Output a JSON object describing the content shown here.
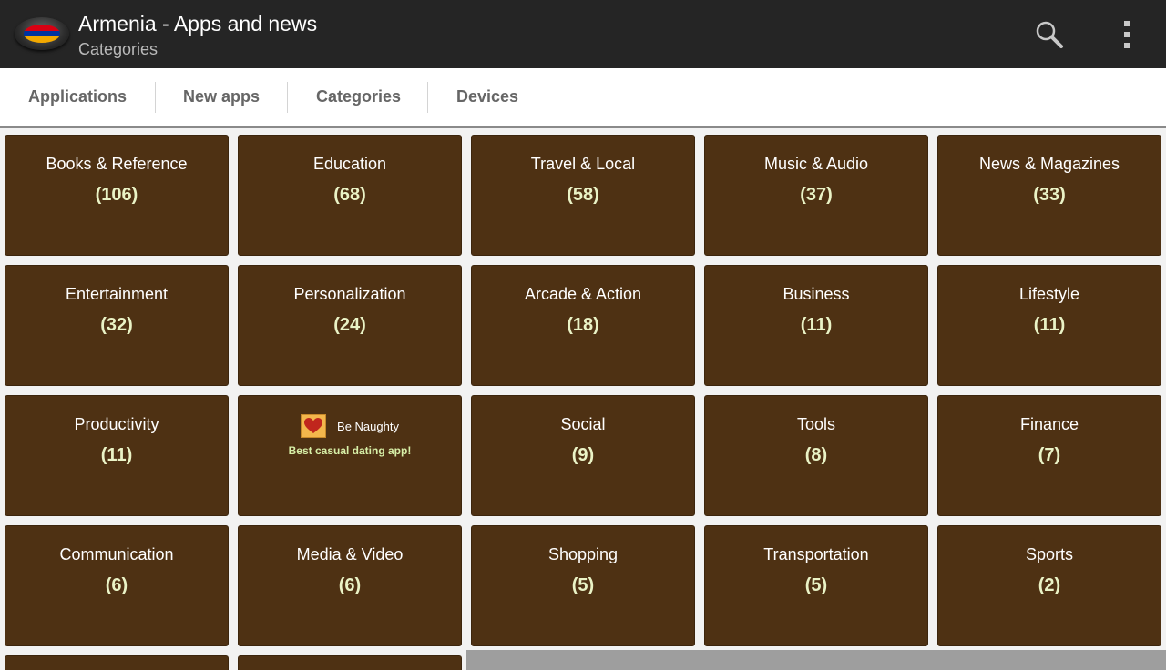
{
  "actionbar": {
    "title": "Armenia - Apps and news",
    "subtitle": "Categories",
    "logo_icon": "armenia-flag-icon",
    "flag_colors": [
      "#d90012",
      "#0033a0",
      "#f2a800"
    ],
    "search_icon": "search-icon",
    "menu_icon": "overflow-menu-icon"
  },
  "tabs": [
    {
      "label": "Applications"
    },
    {
      "label": "New apps"
    },
    {
      "label": "Categories"
    },
    {
      "label": "Devices"
    }
  ],
  "categories": [
    {
      "name": "Books & Reference",
      "count": "(106)"
    },
    {
      "name": "Education",
      "count": "(68)"
    },
    {
      "name": "Travel & Local",
      "count": "(58)"
    },
    {
      "name": "Music & Audio",
      "count": "(37)"
    },
    {
      "name": "News & Magazines",
      "count": "(33)"
    },
    {
      "name": "Entertainment",
      "count": "(32)"
    },
    {
      "name": "Personalization",
      "count": "(24)"
    },
    {
      "name": "Arcade & Action",
      "count": "(18)"
    },
    {
      "name": "Business",
      "count": "(11)"
    },
    {
      "name": "Lifestyle",
      "count": "(11)"
    },
    {
      "name": "Productivity",
      "count": "(11)"
    },
    {
      "name": "Social",
      "count": "(9)"
    },
    {
      "name": "Tools",
      "count": "(8)"
    },
    {
      "name": "Finance",
      "count": "(7)"
    },
    {
      "name": "Communication",
      "count": "(6)"
    },
    {
      "name": "Media & Video",
      "count": "(6)"
    },
    {
      "name": "Shopping",
      "count": "(5)"
    },
    {
      "name": "Transportation",
      "count": "(5)"
    },
    {
      "name": "Sports",
      "count": "(2)"
    }
  ],
  "ad": {
    "name": "Be Naughty",
    "tagline": "Best casual dating app!",
    "icon": "heart-icon"
  },
  "colors": {
    "tile_bg": "#4e3113",
    "count_text": "#eaf3c6",
    "actionbar_bg": "#252525"
  }
}
